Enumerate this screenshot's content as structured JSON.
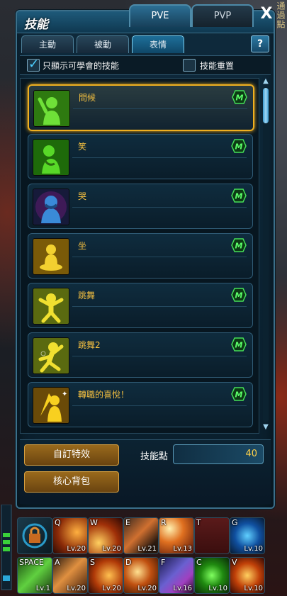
{
  "background": {
    "hint_text": "通過點"
  },
  "window": {
    "title": "技能",
    "mode_tabs": [
      {
        "label": "PVE",
        "active": true
      },
      {
        "label": "PVP",
        "active": false
      }
    ],
    "close_label": "X",
    "help_label": "?",
    "sub_tabs": [
      {
        "label": "主動",
        "active": false
      },
      {
        "label": "被動",
        "active": false
      },
      {
        "label": "表情",
        "active": true
      }
    ],
    "filters": {
      "show_learnable": {
        "label": "只顯示可學會的技能",
        "checked": true
      },
      "reset_skills": {
        "label": "技能重置",
        "checked": false
      }
    },
    "skills": [
      {
        "name": "問候",
        "badge": "M",
        "selected": true,
        "icon": "wave-emote-icon",
        "color": "#3cd11e"
      },
      {
        "name": "笑",
        "badge": "M",
        "selected": false,
        "icon": "laugh-emote-icon",
        "color": "#3cd11e"
      },
      {
        "name": "哭",
        "badge": "M",
        "selected": false,
        "icon": "cry-emote-icon",
        "color": "#2a78c8"
      },
      {
        "name": "坐",
        "badge": "M",
        "selected": false,
        "icon": "sit-emote-icon",
        "color": "#e8c020"
      },
      {
        "name": "跳舞",
        "badge": "M",
        "selected": false,
        "icon": "dance-emote-icon",
        "color": "#e0d020"
      },
      {
        "name": "跳舞2",
        "badge": "M",
        "selected": false,
        "icon": "dance2-emote-icon",
        "color": "#e0d020"
      },
      {
        "name": "轉職的喜悅！",
        "badge": "M",
        "selected": false,
        "icon": "joy-emote-icon",
        "color": "#f0c010"
      }
    ],
    "buttons": {
      "custom_effects": "自訂特效",
      "core_bag": "核心背包"
    },
    "skill_points": {
      "label": "技能點",
      "value": "40"
    }
  },
  "hotbar": {
    "row1": [
      {
        "key": "",
        "level": "",
        "icon": "lock-icon"
      },
      {
        "key": "Q",
        "level": "Lv.20",
        "icon": "slash-skill-icon"
      },
      {
        "key": "W",
        "level": "Lv.20",
        "icon": "fire-strike-icon"
      },
      {
        "key": "E",
        "level": "Lv.21",
        "icon": "blade-rain-icon"
      },
      {
        "key": "R",
        "level": "Lv.13",
        "icon": "light-burst-icon"
      },
      {
        "key": "T",
        "level": "",
        "icon": "empty-slot-icon"
      },
      {
        "key": "G",
        "level": "Lv.10",
        "icon": "blue-aura-icon"
      }
    ],
    "row2": [
      {
        "key": "SPACE",
        "level": "Lv.1",
        "icon": "green-dash-icon"
      },
      {
        "key": "A",
        "level": "Lv.20",
        "icon": "sword-volley-icon"
      },
      {
        "key": "S",
        "level": "Lv.20",
        "icon": "flame-blade-icon"
      },
      {
        "key": "D",
        "level": "Lv.20",
        "icon": "spin-slash-icon"
      },
      {
        "key": "F",
        "level": "Lv.16",
        "icon": "storm-blade-icon"
      },
      {
        "key": "C",
        "level": "Lv.10",
        "icon": "green-orb-icon"
      },
      {
        "key": "V",
        "level": "Lv.10",
        "icon": "fire-vortex-icon"
      }
    ]
  }
}
